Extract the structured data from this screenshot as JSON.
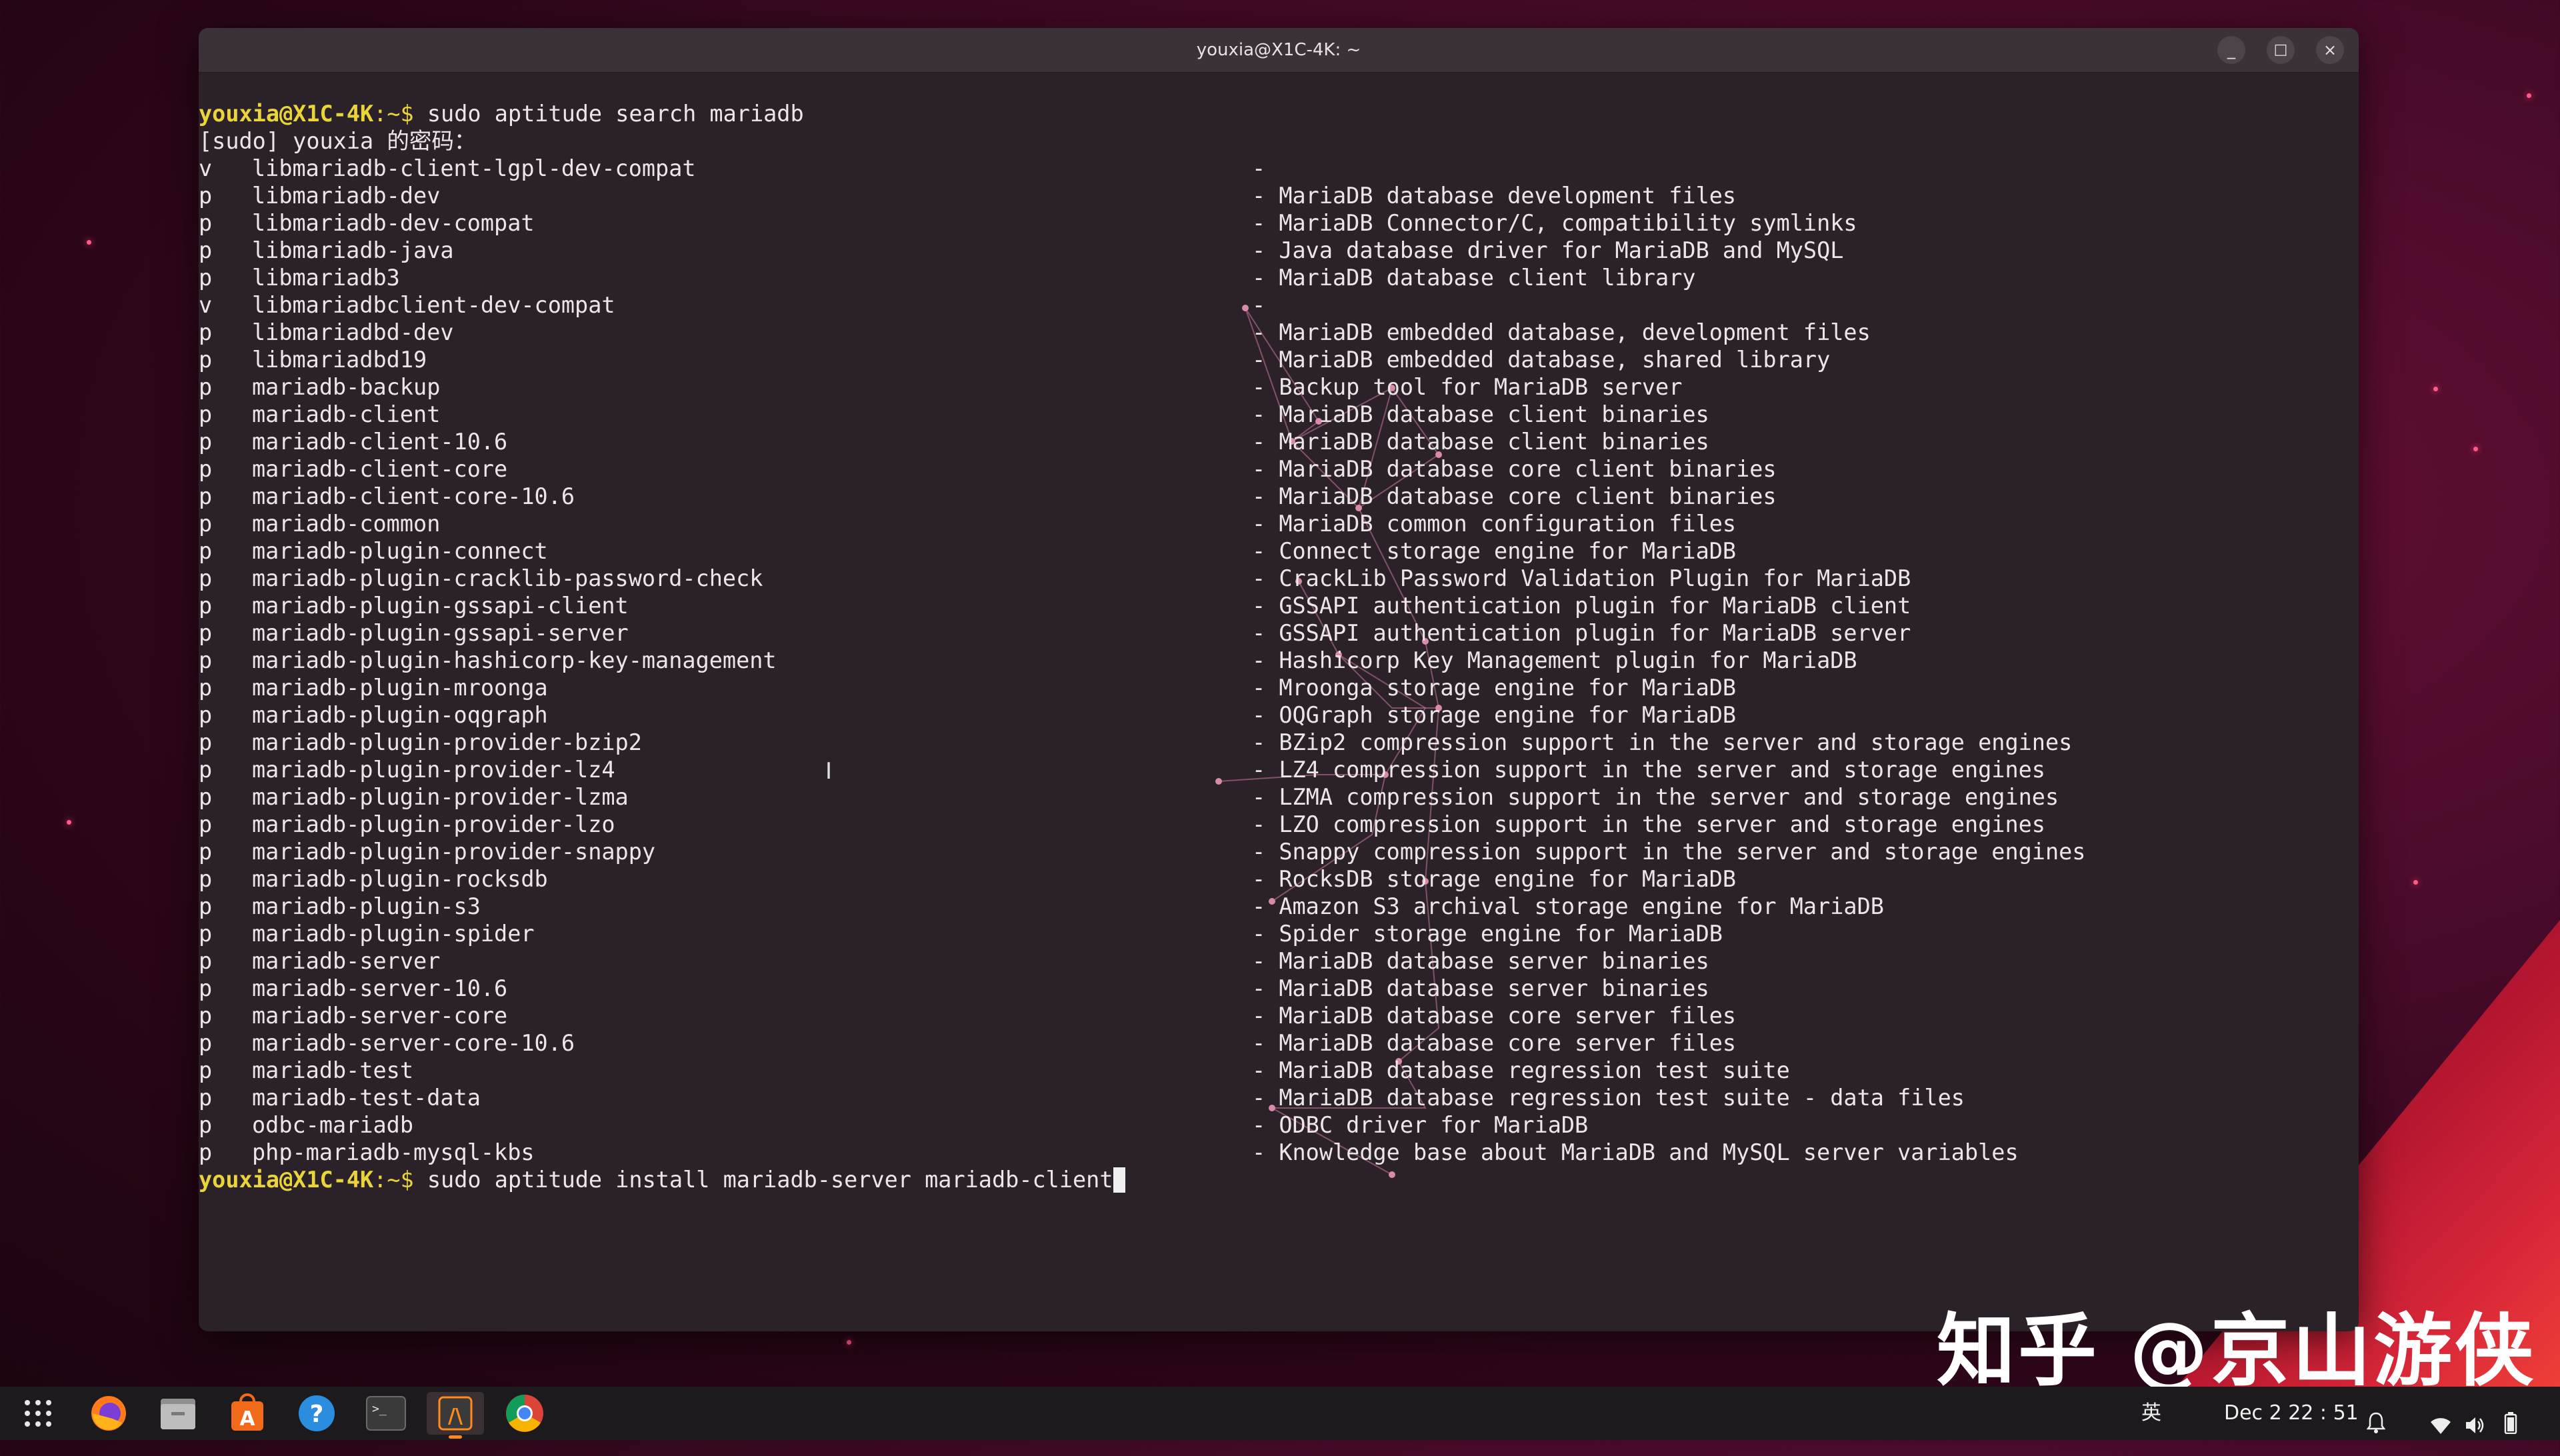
{
  "window": {
    "title": "youxia@X1C-4K: ~",
    "minimize": "_",
    "maximize": "□",
    "close": "×"
  },
  "terminal": {
    "prompt_user": "youxia@X1C-4K",
    "prompt_suffix": ":~$ ",
    "command1": "sudo aptitude search mariadb",
    "sudo_line": "[sudo] youxia 的密码：",
    "packages": [
      {
        "state": "v",
        "name": "libmariadb-client-lgpl-dev-compat",
        "desc": "-"
      },
      {
        "state": "p",
        "name": "libmariadb-dev",
        "desc": "- MariaDB database development files"
      },
      {
        "state": "p",
        "name": "libmariadb-dev-compat",
        "desc": "- MariaDB Connector/C, compatibility symlinks"
      },
      {
        "state": "p",
        "name": "libmariadb-java",
        "desc": "- Java database driver for MariaDB and MySQL"
      },
      {
        "state": "p",
        "name": "libmariadb3",
        "desc": "- MariaDB database client library"
      },
      {
        "state": "v",
        "name": "libmariadbclient-dev-compat",
        "desc": "-"
      },
      {
        "state": "p",
        "name": "libmariadbd-dev",
        "desc": "- MariaDB embedded database, development files"
      },
      {
        "state": "p",
        "name": "libmariadbd19",
        "desc": "- MariaDB embedded database, shared library"
      },
      {
        "state": "p",
        "name": "mariadb-backup",
        "desc": "- Backup tool for MariaDB server"
      },
      {
        "state": "p",
        "name": "mariadb-client",
        "desc": "- MariaDB database client binaries"
      },
      {
        "state": "p",
        "name": "mariadb-client-10.6",
        "desc": "- MariaDB database client binaries"
      },
      {
        "state": "p",
        "name": "mariadb-client-core",
        "desc": "- MariaDB database core client binaries"
      },
      {
        "state": "p",
        "name": "mariadb-client-core-10.6",
        "desc": "- MariaDB database core client binaries"
      },
      {
        "state": "p",
        "name": "mariadb-common",
        "desc": "- MariaDB common configuration files"
      },
      {
        "state": "p",
        "name": "mariadb-plugin-connect",
        "desc": "- Connect storage engine for MariaDB"
      },
      {
        "state": "p",
        "name": "mariadb-plugin-cracklib-password-check",
        "desc": "- CrackLib Password Validation Plugin for MariaDB"
      },
      {
        "state": "p",
        "name": "mariadb-plugin-gssapi-client",
        "desc": "- GSSAPI authentication plugin for MariaDB client"
      },
      {
        "state": "p",
        "name": "mariadb-plugin-gssapi-server",
        "desc": "- GSSAPI authentication plugin for MariaDB server"
      },
      {
        "state": "p",
        "name": "mariadb-plugin-hashicorp-key-management",
        "desc": "- Hashicorp Key Management plugin for MariaDB"
      },
      {
        "state": "p",
        "name": "mariadb-plugin-mroonga",
        "desc": "- Mroonga storage engine for MariaDB"
      },
      {
        "state": "p",
        "name": "mariadb-plugin-oqgraph",
        "desc": "- OQGraph storage engine for MariaDB"
      },
      {
        "state": "p",
        "name": "mariadb-plugin-provider-bzip2",
        "desc": "- BZip2 compression support in the server and storage engines"
      },
      {
        "state": "p",
        "name": "mariadb-plugin-provider-lz4",
        "desc": "- LZ4 compression support in the server and storage engines"
      },
      {
        "state": "p",
        "name": "mariadb-plugin-provider-lzma",
        "desc": "- LZMA compression support in the server and storage engines"
      },
      {
        "state": "p",
        "name": "mariadb-plugin-provider-lzo",
        "desc": "- LZO compression support in the server and storage engines"
      },
      {
        "state": "p",
        "name": "mariadb-plugin-provider-snappy",
        "desc": "- Snappy compression support in the server and storage engines"
      },
      {
        "state": "p",
        "name": "mariadb-plugin-rocksdb",
        "desc": "- RocksDB storage engine for MariaDB"
      },
      {
        "state": "p",
        "name": "mariadb-plugin-s3",
        "desc": "- Amazon S3 archival storage engine for MariaDB"
      },
      {
        "state": "p",
        "name": "mariadb-plugin-spider",
        "desc": "- Spider storage engine for MariaDB"
      },
      {
        "state": "p",
        "name": "mariadb-server",
        "desc": "- MariaDB database server binaries"
      },
      {
        "state": "p",
        "name": "mariadb-server-10.6",
        "desc": "- MariaDB database server binaries"
      },
      {
        "state": "p",
        "name": "mariadb-server-core",
        "desc": "- MariaDB database core server files"
      },
      {
        "state": "p",
        "name": "mariadb-server-core-10.6",
        "desc": "- MariaDB database core server files"
      },
      {
        "state": "p",
        "name": "mariadb-test",
        "desc": "- MariaDB database regression test suite"
      },
      {
        "state": "p",
        "name": "mariadb-test-data",
        "desc": "- MariaDB database regression test suite - data files"
      },
      {
        "state": "p",
        "name": "odbc-mariadb",
        "desc": "- ODBC driver for MariaDB"
      },
      {
        "state": "p",
        "name": "php-mariadb-mysql-kbs",
        "desc": "- Knowledge base about MariaDB and MySQL server variables"
      }
    ],
    "command2": "sudo aptitude install mariadb-server mariadb-client",
    "text_cursor": "I"
  },
  "watermark": "知乎 @京山游侠",
  "dock": {
    "apps": [
      {
        "icon": "app-grid-icon",
        "name": "Show Applications"
      },
      {
        "icon": "firefox-icon",
        "name": "Firefox"
      },
      {
        "icon": "files-icon",
        "name": "Files"
      },
      {
        "icon": "software-store-icon",
        "name": "Ubuntu Software"
      },
      {
        "icon": "help-icon",
        "name": "Help"
      },
      {
        "icon": "terminal-icon",
        "name": "Terminal"
      },
      {
        "icon": "sublime-icon",
        "name": "Sublime"
      },
      {
        "icon": "chrome-icon",
        "name": "Chrome"
      }
    ],
    "help_glyph": "?",
    "terminal_glyph": ">_",
    "store_glyph": "A",
    "sublime_glyph": "/\\"
  },
  "status_bar": {
    "input_method": "英",
    "datetime": "Dec 2  22 : 51",
    "icons": [
      "notification-icon",
      "wifi-icon",
      "volume-icon",
      "battery-icon"
    ]
  },
  "colors": {
    "prompt": "#e9d43a",
    "terminal_bg": "#2b2229",
    "text": "#ece6ea"
  }
}
